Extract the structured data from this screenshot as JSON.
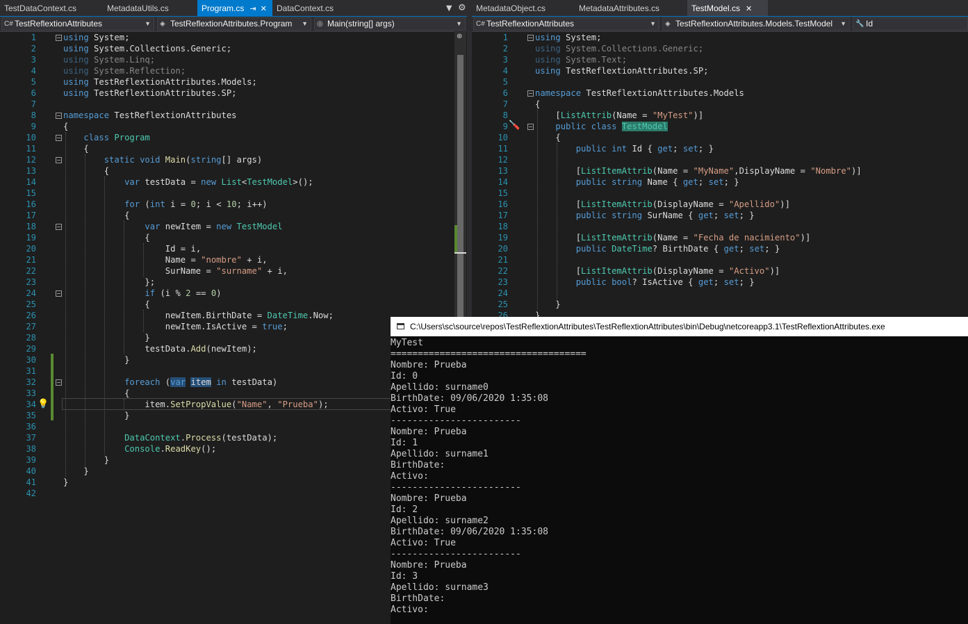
{
  "left_tabs": [
    "TestDataContext.cs",
    "MetadataUtils.cs",
    "Program.cs",
    "DataContext.cs"
  ],
  "left_nav": [
    "TestReflextionAttributes",
    "TestReflextionAttributes.Program",
    "Main(string[] args)"
  ],
  "right_tabs": [
    "MetadataObject.cs",
    "MetadataAttributes.cs",
    "TestModel.cs"
  ],
  "right_nav": [
    "TestReflextionAttributes",
    "TestReflextionAttributes.Models.TestModel",
    "Id"
  ],
  "icons": {
    "pin": "pin-icon",
    "close": "close-icon",
    "dropdown": "chevron-down-icon",
    "settings": "gear-icon",
    "lightbulb": "lightbulb-icon",
    "screwdriver": "screwdriver-icon",
    "csharp": "csharp-file-icon"
  },
  "colors": {
    "accent": "#007acc",
    "keyword": "#569cd6",
    "type": "#4ec9b0",
    "string": "#d69d85"
  },
  "left_code": [
    {
      "n": "1",
      "t": "using System;"
    },
    {
      "n": "2",
      "t": "using System.Collections.Generic;"
    },
    {
      "n": "3",
      "t": "using System.Linq;"
    },
    {
      "n": "4",
      "t": "using System.Reflection;"
    },
    {
      "n": "5",
      "t": "using TestReflextionAttributes.Models;"
    },
    {
      "n": "6",
      "t": "using TestReflextionAttributes.SP;"
    },
    {
      "n": "7",
      "t": ""
    },
    {
      "n": "8",
      "t": "namespace TestReflextionAttributes"
    },
    {
      "n": "9",
      "t": "{"
    },
    {
      "n": "10",
      "t": "    class Program"
    },
    {
      "n": "11",
      "t": "    {"
    },
    {
      "n": "12",
      "t": "        static void Main(string[] args)"
    },
    {
      "n": "13",
      "t": "        {"
    },
    {
      "n": "14",
      "t": "            var testData = new List<TestModel>();"
    },
    {
      "n": "15",
      "t": ""
    },
    {
      "n": "16",
      "t": "            for (int i = 0; i < 10; i++)"
    },
    {
      "n": "17",
      "t": "            {"
    },
    {
      "n": "18",
      "t": "                var newItem = new TestModel"
    },
    {
      "n": "19",
      "t": "                {"
    },
    {
      "n": "20",
      "t": "                    Id = i,"
    },
    {
      "n": "21",
      "t": "                    Name = \"nombre\" + i,"
    },
    {
      "n": "22",
      "t": "                    SurName = \"surname\" + i,"
    },
    {
      "n": "23",
      "t": "                };"
    },
    {
      "n": "24",
      "t": "                if (i % 2 == 0)"
    },
    {
      "n": "25",
      "t": "                {"
    },
    {
      "n": "26",
      "t": "                    newItem.BirthDate = DateTime.Now;"
    },
    {
      "n": "27",
      "t": "                    newItem.IsActive = true;"
    },
    {
      "n": "28",
      "t": "                }"
    },
    {
      "n": "29",
      "t": "                testData.Add(newItem);"
    },
    {
      "n": "30",
      "t": "            }"
    },
    {
      "n": "31",
      "t": ""
    },
    {
      "n": "32",
      "t": "            foreach (var item in testData)"
    },
    {
      "n": "33",
      "t": "            {"
    },
    {
      "n": "34",
      "t": "                item.SetPropValue(\"Name\", \"Prueba\");"
    },
    {
      "n": "35",
      "t": "            }"
    },
    {
      "n": "36",
      "t": ""
    },
    {
      "n": "37",
      "t": "            DataContext.Process(testData);"
    },
    {
      "n": "38",
      "t": "            Console.ReadKey();"
    },
    {
      "n": "39",
      "t": "        }"
    },
    {
      "n": "40",
      "t": "    }"
    },
    {
      "n": "41",
      "t": "}"
    },
    {
      "n": "42",
      "t": ""
    }
  ],
  "right_code": [
    {
      "n": "1",
      "t": "using System;"
    },
    {
      "n": "2",
      "t": "using System.Collections.Generic;"
    },
    {
      "n": "3",
      "t": "using System.Text;"
    },
    {
      "n": "4",
      "t": "using TestReflextionAttributes.SP;"
    },
    {
      "n": "5",
      "t": ""
    },
    {
      "n": "6",
      "t": "namespace TestReflextionAttributes.Models"
    },
    {
      "n": "7",
      "t": "{"
    },
    {
      "n": "8",
      "t": "    [ListAttrib(Name = \"MyTest\")]"
    },
    {
      "n": "9",
      "t": "    public class TestModel"
    },
    {
      "n": "10",
      "t": "    {"
    },
    {
      "n": "11",
      "t": "        public int Id { get; set; }"
    },
    {
      "n": "12",
      "t": ""
    },
    {
      "n": "13",
      "t": "        [ListItemAttrib(Name = \"MyName\",DisplayName = \"Nombre\")]"
    },
    {
      "n": "14",
      "t": "        public string Name { get; set; }"
    },
    {
      "n": "15",
      "t": ""
    },
    {
      "n": "16",
      "t": "        [ListItemAttrib(DisplayName = \"Apellido\")]"
    },
    {
      "n": "17",
      "t": "        public string SurName { get; set; }"
    },
    {
      "n": "18",
      "t": ""
    },
    {
      "n": "19",
      "t": "        [ListItemAttrib(Name = \"Fecha de nacimiento\")]"
    },
    {
      "n": "20",
      "t": "        public DateTime? BirthDate { get; set; }"
    },
    {
      "n": "21",
      "t": ""
    },
    {
      "n": "22",
      "t": "        [ListItemAttrib(DisplayName = \"Activo\")]"
    },
    {
      "n": "23",
      "t": "        public bool? IsActive { get; set; }"
    },
    {
      "n": "24",
      "t": ""
    },
    {
      "n": "25",
      "t": "    }"
    },
    {
      "n": "26",
      "t": "}"
    }
  ],
  "console": {
    "title": "C:\\Users\\sc\\source\\repos\\TestReflextionAttributes\\TestReflextionAttributes\\bin\\Debug\\netcoreapp3.1\\TestReflextionAttributes.exe",
    "lines": [
      "MyTest",
      "====================================",
      "Nombre: Prueba",
      "Id: 0",
      "Apellido: surname0",
      "BirthDate: 09/06/2020 1:35:08",
      "Activo: True",
      "------------------------",
      "Nombre: Prueba",
      "Id: 1",
      "Apellido: surname1",
      "BirthDate:",
      "Activo:",
      "------------------------",
      "Nombre: Prueba",
      "Id: 2",
      "Apellido: surname2",
      "BirthDate: 09/06/2020 1:35:08",
      "Activo: True",
      "------------------------",
      "Nombre: Prueba",
      "Id: 3",
      "Apellido: surname3",
      "BirthDate:",
      "Activo:"
    ]
  }
}
